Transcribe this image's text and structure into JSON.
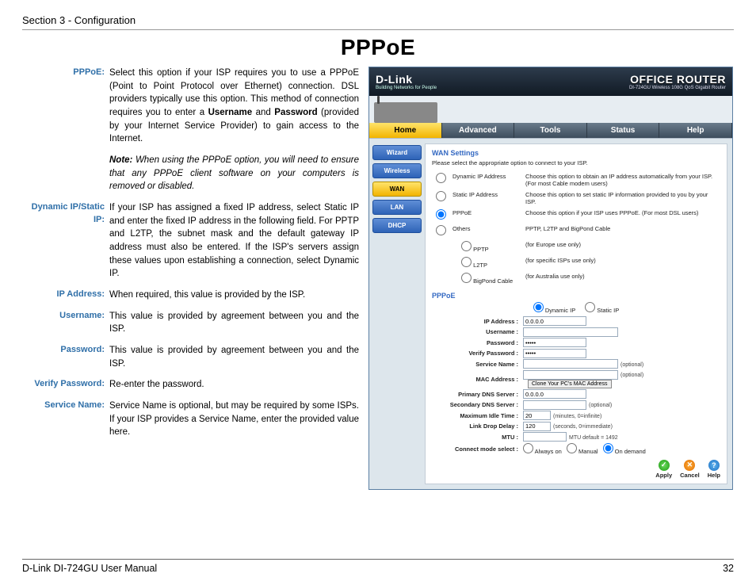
{
  "header": "Section 3 - Configuration",
  "page_title": "PPPoE",
  "definitions": [
    {
      "label": "PPPoE:",
      "body": "Select this option if your ISP requires you to use a PPPoE (Point to Point Protocol over Ethernet) connection. DSL providers typically use this option. This method of connection requires you to enter a <b>Username</b> and <b>Password</b> (provided by your Internet Service Provider) to gain access to the Internet."
    },
    {
      "note": true,
      "body": "<b>Note:</b> When using the PPPoE option, you will need to ensure that any PPPoE client software on your computers is removed or disabled."
    },
    {
      "label": "Dynamic IP/Static IP:",
      "body": "If your ISP has assigned a fixed IP address, select Static IP and enter the fixed IP address in the following field. For PPTP and L2TP, the subnet mask and the default gateway IP address must also be entered. If the ISP's servers assign these values upon establishing a connection, select Dynamic IP."
    },
    {
      "label": "IP Address:",
      "body": "When required, this value is provided by the ISP."
    },
    {
      "label": "Username:",
      "body": "This value is provided by agreement between you and the ISP."
    },
    {
      "label": "Password:",
      "body": "This value is provided by agreement between you and the ISP."
    },
    {
      "label": "Verify Password:",
      "body": "Re-enter the password."
    },
    {
      "label": "Service Name:",
      "body": "Service Name is optional, but may be required by some ISPs. If your ISP provides a Service Name, enter the provided value here."
    }
  ],
  "router": {
    "brand": "D-Link",
    "brand_tag": "Building Networks for People",
    "product_title": "OFFICE ROUTER",
    "product_sub": "DI-724GU Wireless 108G QoS Gigabit Router",
    "tabs": [
      "Home",
      "Advanced",
      "Tools",
      "Status",
      "Help"
    ],
    "active_tab": 0,
    "sidenav": [
      "Wizard",
      "Wireless",
      "WAN",
      "LAN",
      "DHCP"
    ],
    "sidenav_selected": 2,
    "wan_heading": "WAN Settings",
    "wan_sub": "Please select the appropriate option to connect to your ISP.",
    "wan_options": [
      {
        "name": "Dynamic IP Address",
        "desc": "Choose this option to obtain an IP address automatically from your ISP. (For most Cable modem users)",
        "checked": false
      },
      {
        "name": "Static IP Address",
        "desc": "Choose this option to set static IP information provided to you by your ISP.",
        "checked": false
      },
      {
        "name": "PPPoE",
        "desc": "Choose this option if your ISP uses PPPoE. (For most DSL users)",
        "checked": true
      },
      {
        "name": "Others",
        "desc": "PPTP, L2TP and BigPond Cable",
        "checked": false
      }
    ],
    "other_subs": [
      {
        "name": "PPTP",
        "desc": "(for Europe use only)"
      },
      {
        "name": "L2TP",
        "desc": "(for specific ISPs use only)"
      },
      {
        "name": "BigPond Cable",
        "desc": "(for Australia use only)"
      }
    ],
    "pppoe_heading": "PPPoE",
    "ip_mode": [
      {
        "name": "Dynamic IP",
        "checked": true
      },
      {
        "name": "Static IP",
        "checked": false
      }
    ],
    "fields": {
      "ip_address": {
        "label": "IP Address :",
        "value": "0.0.0.0"
      },
      "username": {
        "label": "Username :",
        "value": ""
      },
      "password": {
        "label": "Password :",
        "value": "•••••"
      },
      "verify_password": {
        "label": "Verify Password :",
        "value": "•••••"
      },
      "service_name": {
        "label": "Service Name :",
        "value": "",
        "hint": "(optional)"
      },
      "mac_address": {
        "label": "MAC Address :",
        "value": "",
        "hint": "(optional)",
        "button": "Clone Your PC's MAC Address"
      },
      "primary_dns": {
        "label": "Primary DNS Server :",
        "value": "0.0.0.0"
      },
      "secondary_dns": {
        "label": "Secondary DNS Server :",
        "value": "",
        "hint": "(optional)"
      },
      "idle": {
        "label": "Maximum Idle Time :",
        "value": "20",
        "hint": "(minutes, 0=infinite)"
      },
      "link_drop": {
        "label": "Link Drop Delay :",
        "value": "120",
        "hint": "(seconds, 0=immediate)"
      },
      "mtu": {
        "label": "MTU :",
        "value": "",
        "hint": "MTU default = 1492"
      },
      "connect_mode": {
        "label": "Connect mode select :",
        "options": [
          "Always on",
          "Manual",
          "On demand"
        ],
        "selected": 2
      }
    },
    "actions": [
      "Apply",
      "Cancel",
      "Help"
    ]
  },
  "footer": {
    "left": "D-Link DI-724GU User Manual",
    "right": "32"
  }
}
